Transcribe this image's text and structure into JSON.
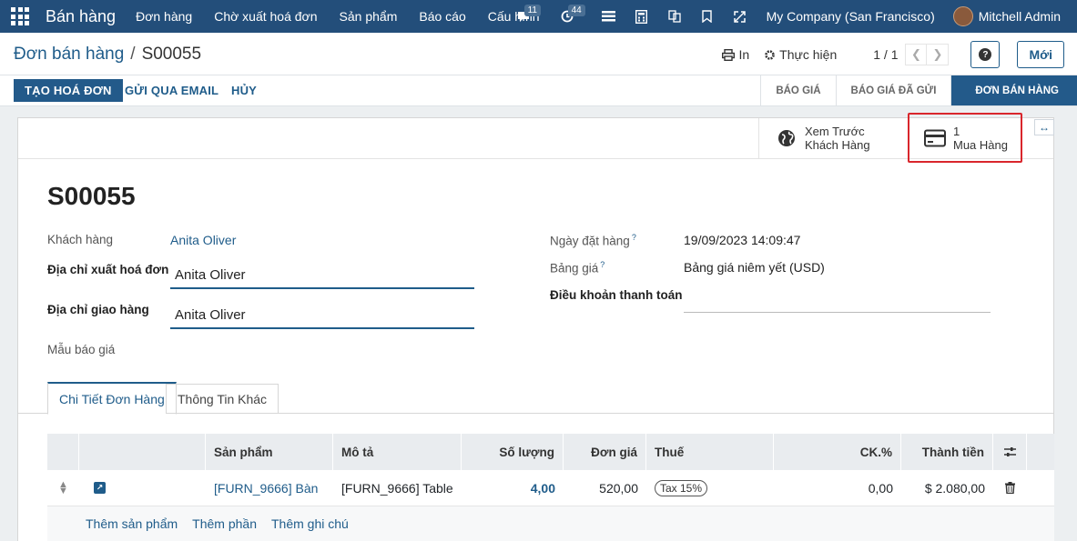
{
  "navbar": {
    "brand": "Bán hàng",
    "menu": [
      "Đơn hàng",
      "Chờ xuất hoá đơn",
      "Sản phẩm",
      "Báo cáo",
      "Cấu hình"
    ],
    "messages_count": "11",
    "activities_count": "44",
    "company": "My Company (San Francisco)",
    "user": "Mitchell Admin"
  },
  "control": {
    "breadcrumb_parent": "Đơn bán hàng",
    "breadcrumb_sep": "/",
    "breadcrumb_current": "S00055",
    "print_label": "In",
    "action_label": "Thực hiện",
    "pager": "1 / 1",
    "new_label": "Mới"
  },
  "statusbar": {
    "create_invoice": "TẠO HOÁ ĐƠN",
    "send_email": "GỬI QUA EMAIL",
    "cancel": "HỦY",
    "stages": [
      "BÁO GIÁ",
      "BÁO GIÁ ĐÃ GỬI",
      "ĐƠN BÁN HÀNG"
    ],
    "active_stage": "ĐƠN BÁN HÀNG"
  },
  "smart_buttons": {
    "preview_line1": "Xem Trước",
    "preview_line2": "Khách Hàng",
    "purchase_count": "1",
    "purchase_label": "Mua Hàng"
  },
  "record": {
    "name": "S00055",
    "customer_label": "Khách hàng",
    "customer": "Anita Oliver",
    "invoice_address_label": "Địa chỉ xuất hoá đơn",
    "invoice_address": "Anita Oliver",
    "delivery_address_label": "Địa chỉ giao hàng",
    "delivery_address": "Anita Oliver",
    "quote_template_label": "Mẫu báo giá",
    "order_date_label": "Ngày đặt hàng",
    "order_date": "19/09/2023 14:09:47",
    "pricelist_label": "Bảng giá",
    "pricelist": "Bảng giá niêm yết (USD)",
    "payment_terms_label": "Điều khoản thanh toán",
    "tooltip_mark": "?"
  },
  "tabs": [
    "Chi Tiết Đơn Hàng",
    "Thông Tin Khác"
  ],
  "table": {
    "headers": [
      "",
      "",
      "Sản phẩm",
      "Mô tả",
      "Số lượng",
      "Đơn giá",
      "Thuế",
      "CK.%",
      "Thành tiền",
      ""
    ],
    "rows": [
      {
        "product": "[FURN_9666] Bàn",
        "description": "[FURN_9666] Table",
        "quantity": "4,00",
        "unit_price": "520,00",
        "tax": "Tax 15%",
        "discount": "0,00",
        "subtotal": "$ 2.080,00"
      }
    ],
    "add_links": [
      "Thêm sản phẩm",
      "Thêm phần",
      "Thêm ghi chú"
    ]
  }
}
